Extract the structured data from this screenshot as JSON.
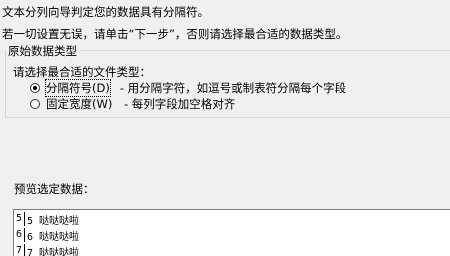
{
  "intro": {
    "line1": "文本分列向导判定您的数据具有分隔符。",
    "line2": "若一切设置无误，请单击“下一步”，否则请选择最合适的数据类型。"
  },
  "data_type_group": {
    "legend": "原始数据类型",
    "prompt": "请选择最合适的文件类型：",
    "options": [
      {
        "label": "分隔符号(D)",
        "description": "- 用分隔字符，如逗号或制表符分隔每个字段",
        "selected": true
      },
      {
        "label": "固定宽度(W)",
        "description": "- 每列字段加空格对齐",
        "selected": false
      }
    ]
  },
  "preview": {
    "label": "预览选定数据：",
    "rows": [
      {
        "num": "5",
        "text": "5 哒哒哒啦"
      },
      {
        "num": "6",
        "text": "6 哒哒哒啦"
      },
      {
        "num": "7",
        "text": "7 哒哒哒啦"
      }
    ]
  }
}
